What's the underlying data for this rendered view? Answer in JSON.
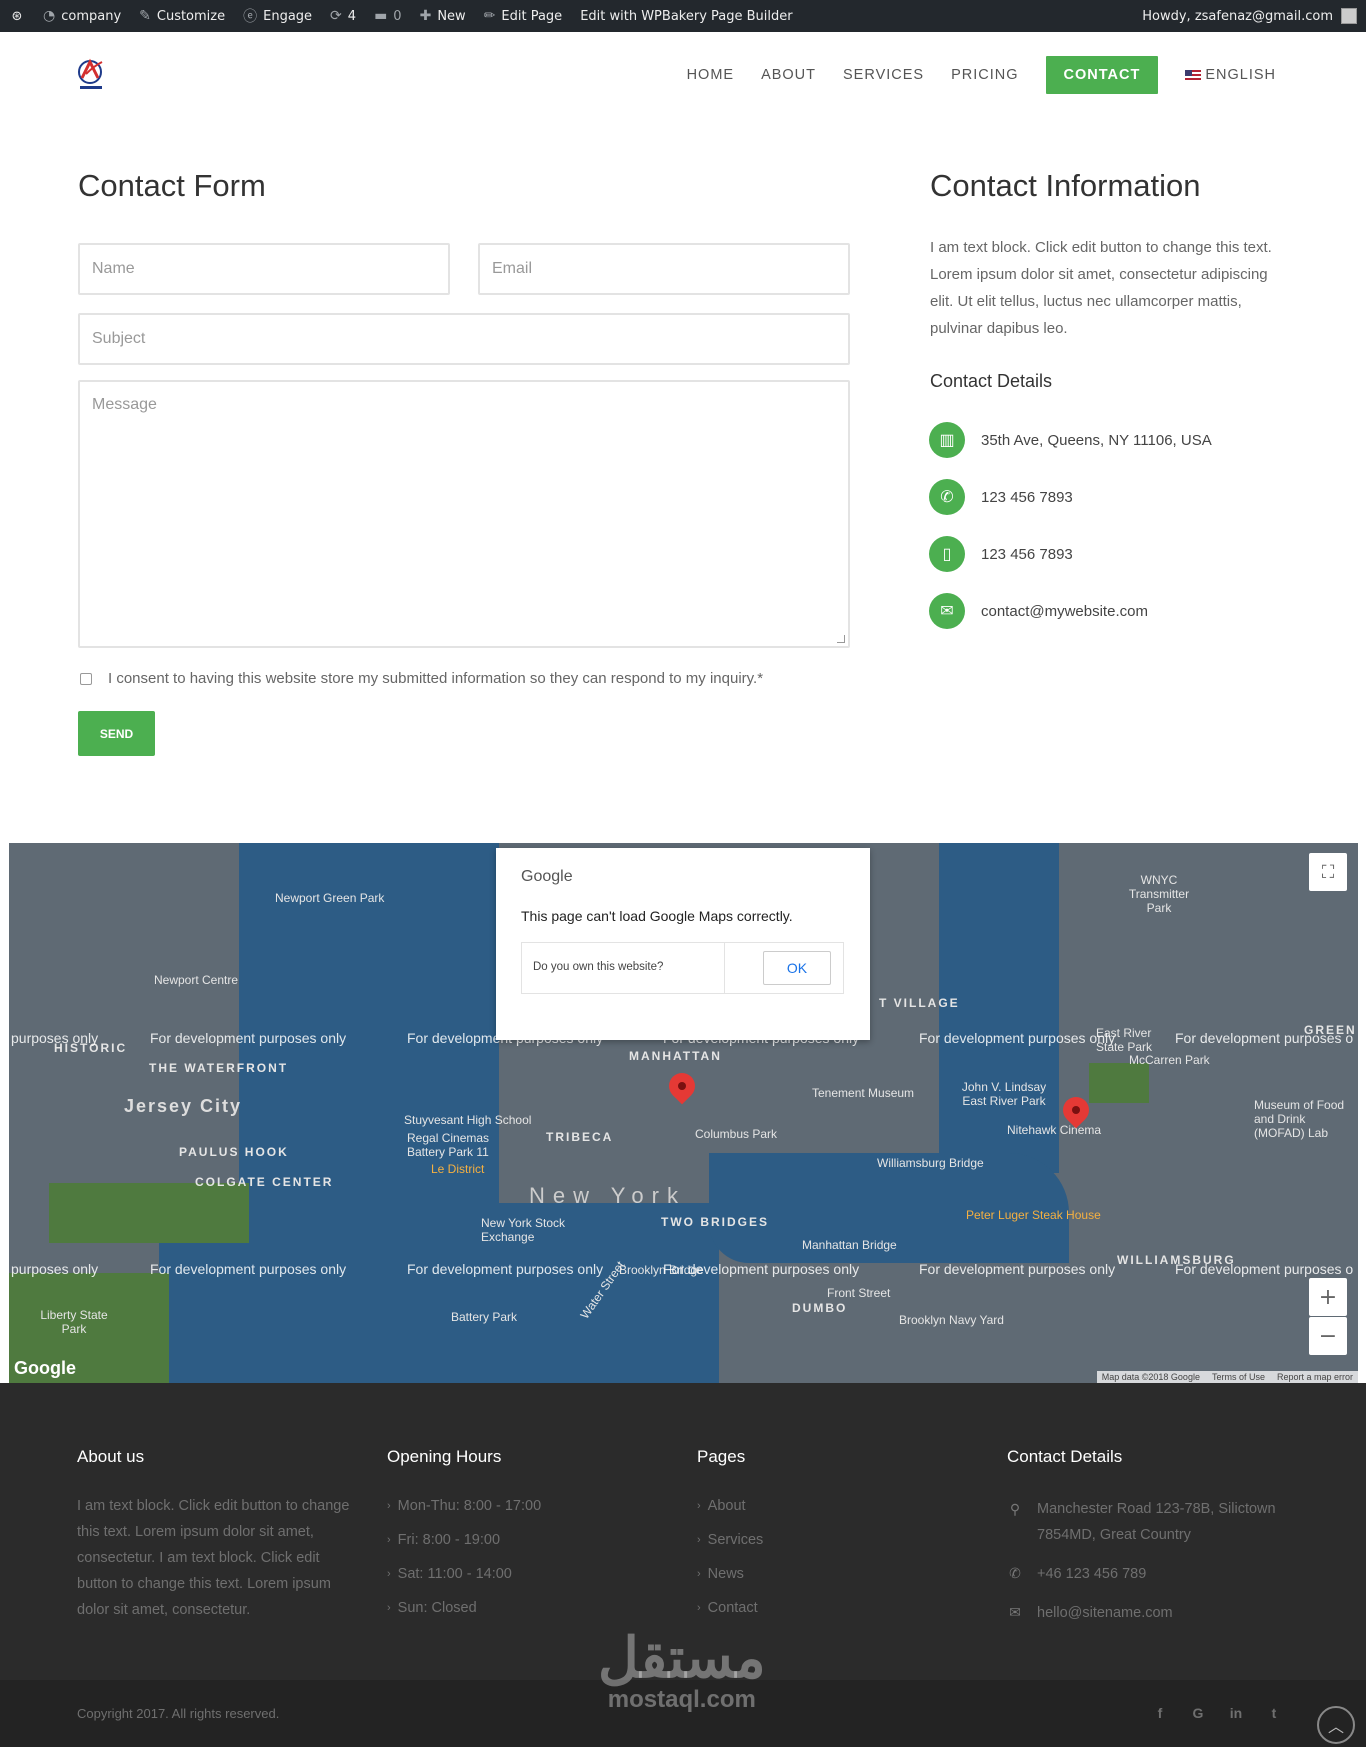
{
  "adminbar": {
    "site": "company",
    "customize": "Customize",
    "engage": "Engage",
    "updates": "4",
    "comments": "0",
    "new": "New",
    "edit_page": "Edit Page",
    "wpbakery": "Edit with WPBakery Page Builder",
    "howdy": "Howdy, zsafenaz@gmail.com"
  },
  "nav": {
    "items": [
      "HOME",
      "ABOUT",
      "SERVICES",
      "PRICING"
    ],
    "contact": "CONTACT",
    "language": "ENGLISH"
  },
  "form": {
    "title": "Contact Form",
    "name_placeholder": "Name",
    "email_placeholder": "Email",
    "subject_placeholder": "Subject",
    "message_placeholder": "Message",
    "consent": "I consent to having this website store my submitted information so they can respond to my inquiry.*",
    "send": "SEND"
  },
  "info": {
    "title": "Contact Information",
    "text": "I am text block. Click edit button to change this text. Lorem ipsum dolor sit amet, consectetur adipiscing elit. Ut elit tellus, luctus nec ullamcorper mattis, pulvinar dapibus leo.",
    "details_title": "Contact Details",
    "address": "35th Ave, Queens, NY 11106, USA",
    "phone": "123 456 7893",
    "mobile": "123 456 7893",
    "email": "contact@mywebsite.com",
    "accent": "#4caf50"
  },
  "map": {
    "dev_text": "For development purposes only",
    "dev_text_partial_left": "purposes only",
    "dev_text_partial_right": "For development purposes o",
    "labels": {
      "jersey_city": "Jersey City",
      "new_york": "New York",
      "manhattan": "MANHATTAN",
      "tribeca": "TRIBECA",
      "two_bridges": "TWO BRIDGES",
      "dumbo": "DUMBO",
      "williamsburg": "WILLIAMSBURG",
      "paulus_hook": "PAULUS HOOK",
      "colgate_center": "COLGATE CENTER",
      "historic": "HISTORIC",
      "waterfront": "THE WATERFRONT",
      "village": "T VILLAGE",
      "greenpoint": "GREEN",
      "newport": "Newport Green Park",
      "newport_centre": "Newport Centre",
      "columbus_park": "Columbus Park",
      "tenement": "Tenement Museum",
      "williamsburg_bridge": "Williamsburg Bridge",
      "manhattan_bridge": "Manhattan Bridge",
      "brooklyn_bridge": "Brooklyn Bridge",
      "brooklyn_navy_yard": "Brooklyn Navy Yard",
      "stuyvesant": "Stuyvesant High School",
      "regal": "Regal Cinemas Battery Park 11",
      "stock_exchange": "New York Stock Exchange",
      "battery_park": "Battery Park",
      "liberty": "Liberty State Park",
      "peter_luger": "Peter Luger Steak House",
      "nitehawk": "Nitehawk Cinema",
      "mccarren": "McCarren Park",
      "museum_food": "Museum of Food and Drink (MOFAD) Lab",
      "wnyc": "WNYC Transmitter Park",
      "east_river_park": "East River State Park",
      "john_lindsay": "John V. Lindsay East River Park",
      "water_street": "Water Street",
      "front_street": "Front Street",
      "le_district": "Le District"
    },
    "google": "Google",
    "map_data": "Map data ©2018 Google",
    "terms": "Terms of Use",
    "report": "Report a map error",
    "dialog": {
      "brand": "Google",
      "message": "This page can't load Google Maps correctly.",
      "question": "Do you own this website?",
      "ok": "OK"
    }
  },
  "footer": {
    "about_title": "About us",
    "about_text": "I am text block. Click edit button to change this text. Lorem ipsum dolor sit amet, consectetur. I am text block. Click edit button to change this text. Lorem ipsum dolor sit amet, consectetur.",
    "hours_title": "Opening Hours",
    "hours": [
      "Mon-Thu: 8:00 - 17:00",
      "Fri: 8:00 - 19:00",
      "Sat: 11:00 - 14:00",
      "Sun: Closed"
    ],
    "pages_title": "Pages",
    "pages": [
      "About",
      "Services",
      "News",
      "Contact"
    ],
    "contact_title": "Contact Details",
    "address_line1": "Manchester Road 123-78B, Silictown",
    "address_line2": "7854MD, Great Country",
    "phone": "+46 123 456 789",
    "email": "hello@sitename.com",
    "copyright": "Copyright 2017. All rights reserved.",
    "social": [
      "f",
      "G",
      "in",
      "t"
    ]
  },
  "watermark": {
    "arabic": "مستقل",
    "latin": "mostaql.com"
  }
}
